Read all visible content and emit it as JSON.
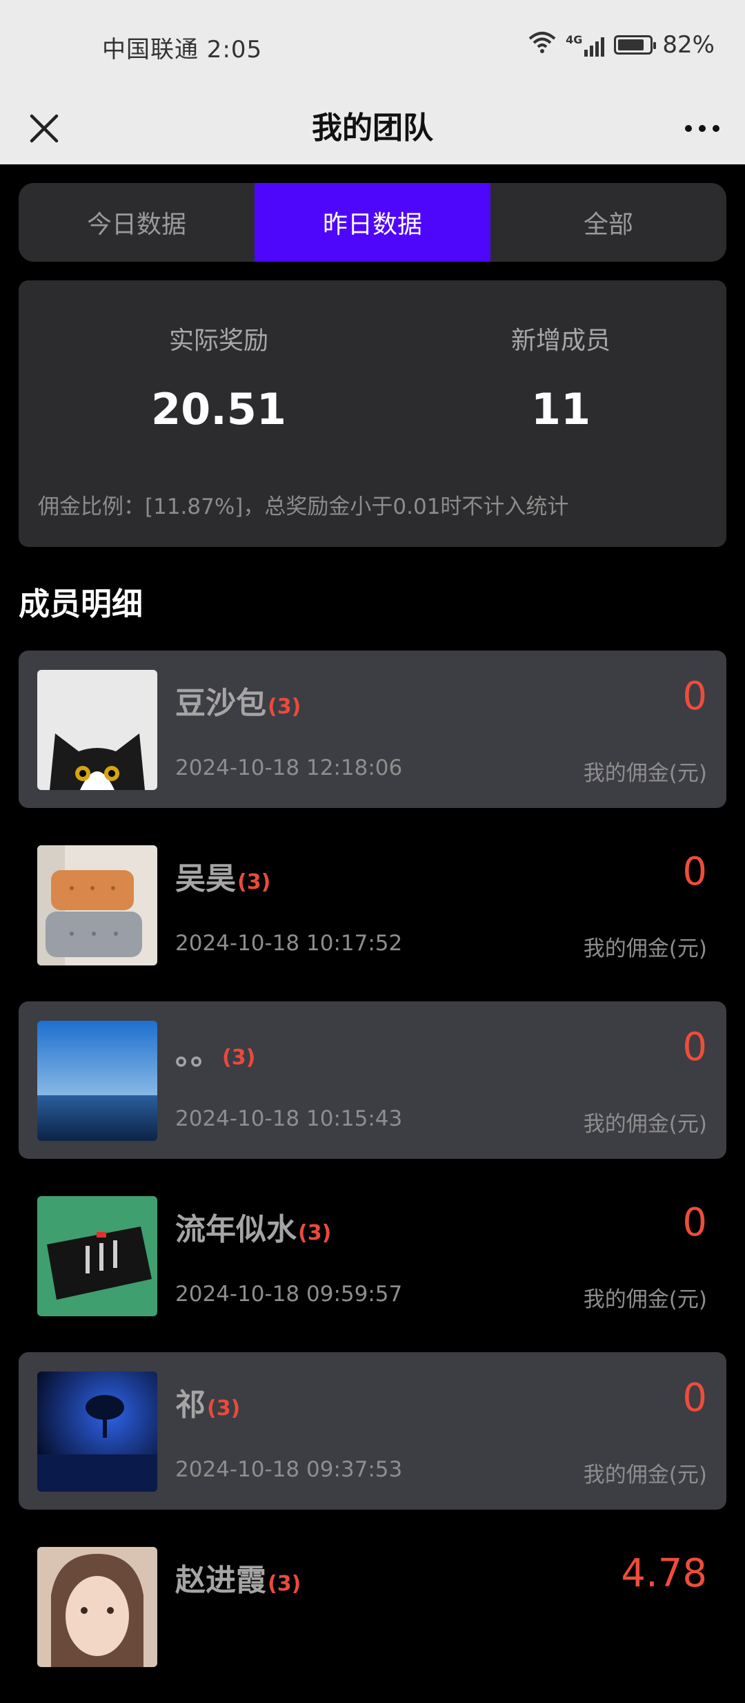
{
  "status": {
    "carrier_time": "中国联通 2:05",
    "network": "4G",
    "battery": "82%",
    "battery_level": 0.82
  },
  "nav": {
    "title": "我的团队"
  },
  "tabs": [
    {
      "label": "今日数据",
      "active": false
    },
    {
      "label": "昨日数据",
      "active": true
    },
    {
      "label": "全部",
      "active": false
    }
  ],
  "summary": {
    "reward_label": "实际奖励",
    "reward_value": "20.51",
    "members_label": "新增成员",
    "members_value": "11",
    "note": "佣金比例：[11.87%]，总奖励金小于0.01时不计入统计"
  },
  "section_title": "成员明细",
  "members": [
    {
      "name": "豆沙包",
      "level": "(3)",
      "date": "2024-10-18 12:18:06",
      "amount": "0",
      "caption": "我的佣金(元)",
      "avatar": "cat-photo"
    },
    {
      "name": "吴昊",
      "level": "(3)",
      "date": "2024-10-18 10:17:52",
      "amount": "0",
      "caption": "我的佣金(元)",
      "avatar": "cushion-photo"
    },
    {
      "name": "。。",
      "level": "(3)",
      "date": "2024-10-18 10:15:43",
      "amount": "0",
      "caption": "我的佣金(元)",
      "avatar": "sea-photo"
    },
    {
      "name": "流年似水",
      "level": "(3)",
      "date": "2024-10-18 09:59:57",
      "amount": "0",
      "caption": "我的佣金(元)",
      "avatar": "device-photo"
    },
    {
      "name": "祁",
      "level": "(3)",
      "date": "2024-10-18 09:37:53",
      "amount": "0",
      "caption": "我的佣金(元)",
      "avatar": "blue-tree-photo"
    },
    {
      "name": "赵进霞",
      "level": "(3)",
      "date": "",
      "amount": "4.78",
      "caption": "",
      "avatar": "portrait-photo"
    }
  ]
}
